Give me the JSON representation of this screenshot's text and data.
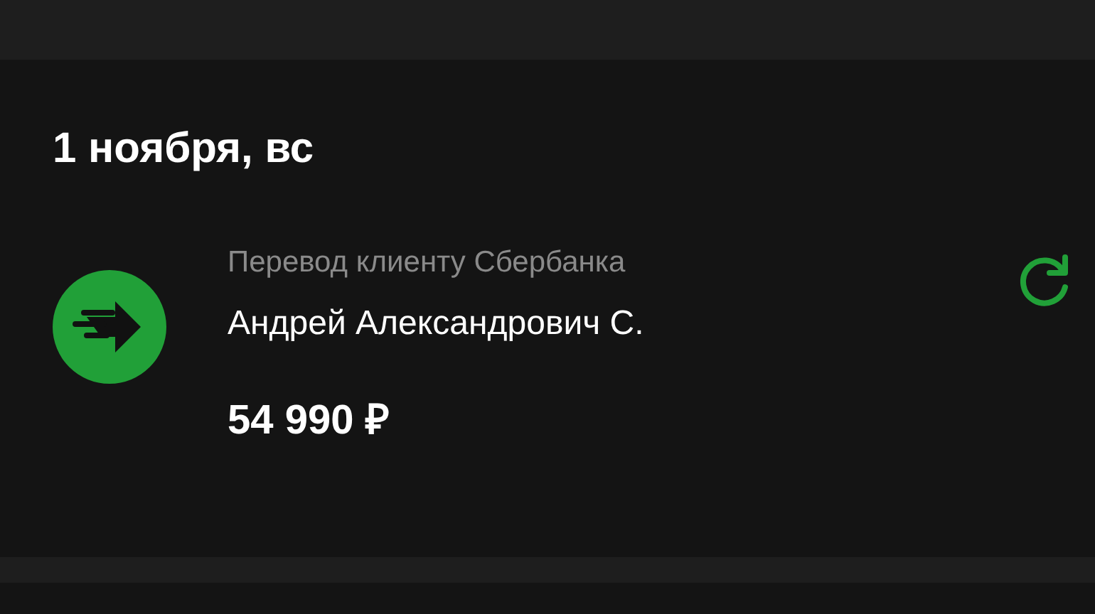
{
  "date_header": "1 ноября, вс",
  "operations": [
    {
      "type": "Перевод клиенту Сбербанка",
      "recipient": "Андрей Александрович С.",
      "amount": "54 990 ₽"
    }
  ]
}
